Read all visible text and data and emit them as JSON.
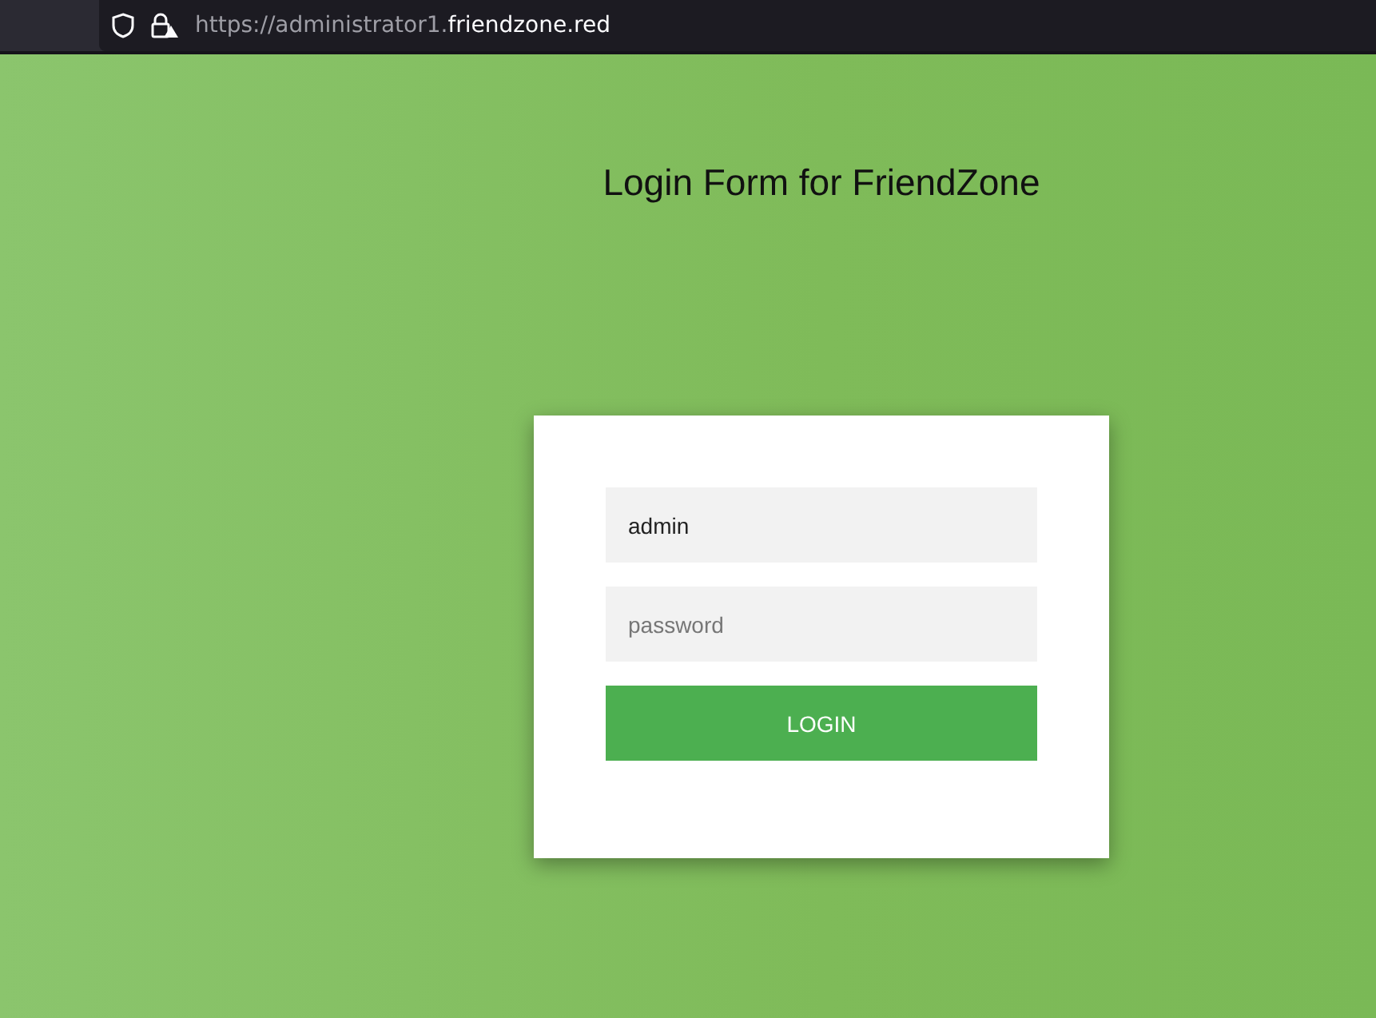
{
  "browser": {
    "url_prefix": "https://administrator1.",
    "url_domain": "friendzone.red"
  },
  "title": "Login Form for FriendZone",
  "form": {
    "username": {
      "value": "admin"
    },
    "password": {
      "placeholder": "password"
    },
    "button": "LOGIN"
  }
}
